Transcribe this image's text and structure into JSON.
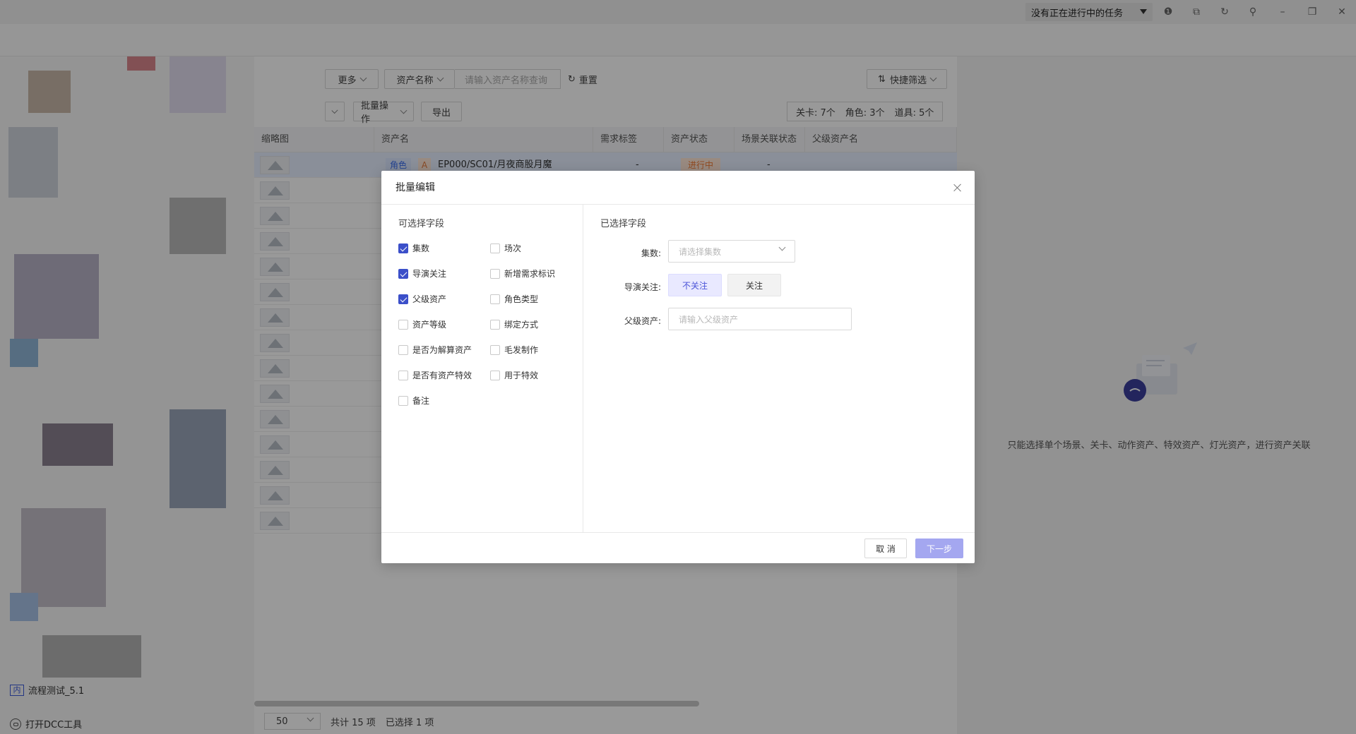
{
  "titlebar": {
    "task_status": "没有正在进行中的任务",
    "icons": [
      "info-icon",
      "translate-icon",
      "refresh-icon",
      "pin-icon",
      "minimize-icon",
      "restore-icon",
      "close-icon"
    ]
  },
  "sidebar": {
    "project_badge": "内",
    "project_name": "流程测试_5.1",
    "dcc_tool": "打开DCC工具"
  },
  "toolbar": {
    "more": "更多",
    "asset_name_select": "资产名称",
    "search_placeholder": "请输入资产名称查询",
    "reset": "重置",
    "quick_filter": "快捷筛选",
    "batch_ops": "批量操作",
    "export": "导出",
    "counts": [
      "关卡: 7个",
      "角色: 3个",
      "道具: 5个"
    ]
  },
  "table": {
    "headers": [
      "缩略图",
      "资产名",
      "需求标签",
      "资产状态",
      "场景关联状态",
      "父级资产名"
    ],
    "row1": {
      "type_tag": "角色",
      "grade_tag": "A",
      "name": "EP000/SC01/月夜商股月魔",
      "demand_tag": "-",
      "status": "进行中",
      "scene_link": "-"
    }
  },
  "footer": {
    "page_size": "50",
    "total": "共计 15 项",
    "selected": "已选择 1 项"
  },
  "right_panel": {
    "empty_text": "只能选择单个场景、关卡、动作资产、特效资产、灯光资产，进行资产关联"
  },
  "modal": {
    "title": "批量编辑",
    "available_title": "可选择字段",
    "selected_title": "已选择字段",
    "fields": [
      {
        "label": "集数",
        "checked": true
      },
      {
        "label": "场次",
        "checked": false
      },
      {
        "label": "导演关注",
        "checked": true
      },
      {
        "label": "新增需求标识",
        "checked": false
      },
      {
        "label": "父级资产",
        "checked": true
      },
      {
        "label": "角色类型",
        "checked": false
      },
      {
        "label": "资产等级",
        "checked": false
      },
      {
        "label": "绑定方式",
        "checked": false
      },
      {
        "label": "是否为解算资产",
        "checked": false
      },
      {
        "label": "毛发制作",
        "checked": false
      },
      {
        "label": "是否有资产特效",
        "checked": false
      },
      {
        "label": "用于特效",
        "checked": false
      },
      {
        "label": "备注",
        "checked": false
      }
    ],
    "form": {
      "episodes_label": "集数:",
      "episodes_placeholder": "请选择集数",
      "director_label": "导演关注:",
      "director_options": [
        "不关注",
        "关注"
      ],
      "parent_label": "父级资产:",
      "parent_placeholder": "请输入父级资产"
    },
    "cancel": "取 消",
    "next": "下一步"
  },
  "colors": {
    "primary": "#3b4fc9",
    "next_disabled": "#a4a7f0",
    "status_orange": "#f07b36"
  }
}
